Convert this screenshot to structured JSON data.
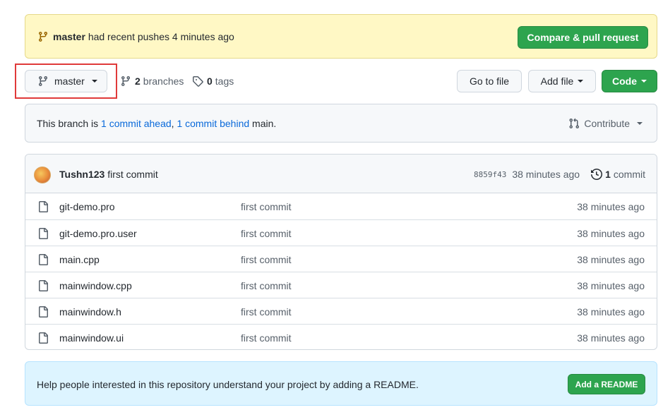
{
  "push_banner": {
    "branch": "master",
    "text": "had recent pushes 4 minutes ago",
    "button_label": "Compare & pull request"
  },
  "toolbar": {
    "branch_selector": "master",
    "branches_count": "2",
    "branches_label": "branches",
    "tags_count": "0",
    "tags_label": "tags",
    "go_to_file": "Go to file",
    "add_file": "Add file",
    "code": "Code"
  },
  "compare_bar": {
    "prefix": "This branch is",
    "ahead": "1 commit ahead",
    "separator": ",",
    "behind": "1 commit behind",
    "suffix": "main.",
    "contribute": "Contribute"
  },
  "latest_commit": {
    "author": "Tushn123",
    "message": "first commit",
    "sha": "8859f43",
    "age": "38 minutes ago",
    "count": "1",
    "count_label": "commit"
  },
  "files": [
    {
      "name": "git-demo.pro",
      "message": "first commit",
      "age": "38 minutes ago"
    },
    {
      "name": "git-demo.pro.user",
      "message": "first commit",
      "age": "38 minutes ago"
    },
    {
      "name": "main.cpp",
      "message": "first commit",
      "age": "38 minutes ago"
    },
    {
      "name": "mainwindow.cpp",
      "message": "first commit",
      "age": "38 minutes ago"
    },
    {
      "name": "mainwindow.h",
      "message": "first commit",
      "age": "38 minutes ago"
    },
    {
      "name": "mainwindow.ui",
      "message": "first commit",
      "age": "38 minutes ago"
    }
  ],
  "readme_banner": {
    "text": "Help people interested in this repository understand your project by adding a README.",
    "button_label": "Add a README"
  },
  "colors": {
    "green": "#2da44e",
    "link": "#0969da",
    "highlight_box": "#e03a3a",
    "push_banner_bg": "#fff8c5",
    "readme_banner_bg": "#ddf4ff"
  }
}
